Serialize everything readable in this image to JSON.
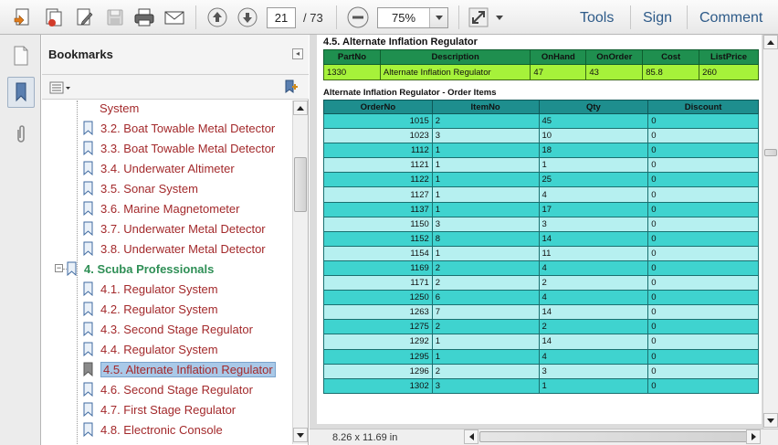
{
  "toolbar": {
    "current_page": "21",
    "total_pages": "/ 73",
    "zoom": "75%",
    "tools_label": "Tools",
    "sign_label": "Sign",
    "comment_label": "Comment"
  },
  "bookmarks_panel": {
    "title": "Bookmarks",
    "items": [
      {
        "label": "System"
      },
      {
        "label": "3.2. Boat Towable Metal Detector"
      },
      {
        "label": "3.3. Boat Towable Metal Detector"
      },
      {
        "label": "3.4. Underwater Altimeter"
      },
      {
        "label": "3.5. Sonar System"
      },
      {
        "label": "3.6. Marine Magnetometer"
      },
      {
        "label": "3.7. Underwater Metal Detector"
      },
      {
        "label": "3.8. Underwater Metal Detector"
      },
      {
        "label": "4. Scuba Professionals"
      },
      {
        "label": "4.1. Regulator System"
      },
      {
        "label": "4.2. Regulator System"
      },
      {
        "label": "4.3. Second Stage Regulator"
      },
      {
        "label": "4.4. Regulator System"
      },
      {
        "label": "4.5. Alternate Inflation Regulator"
      },
      {
        "label": "4.6. Second Stage Regulator"
      },
      {
        "label": "4.7. First Stage Regulator"
      },
      {
        "label": "4.8. Electronic Console"
      }
    ]
  },
  "document": {
    "heading": "4.5. Alternate Inflation Regulator",
    "part_headers": [
      "PartNo",
      "Description",
      "OnHand",
      "OnOrder",
      "Cost",
      "ListPrice"
    ],
    "part_row": [
      "1330",
      "Alternate Inflation Regulator",
      "47",
      "43",
      "85.8",
      "260"
    ],
    "items_title": "Alternate Inflation Regulator - Order Items",
    "items_headers": [
      "OrderNo",
      "ItemNo",
      "Qty",
      "Discount"
    ],
    "items_rows": [
      [
        "1015",
        "2",
        "45",
        "0"
      ],
      [
        "1023",
        "3",
        "10",
        "0"
      ],
      [
        "1112",
        "1",
        "18",
        "0"
      ],
      [
        "1121",
        "1",
        "1",
        "0"
      ],
      [
        "1122",
        "1",
        "25",
        "0"
      ],
      [
        "1127",
        "1",
        "4",
        "0"
      ],
      [
        "1137",
        "1",
        "17",
        "0"
      ],
      [
        "1150",
        "3",
        "3",
        "0"
      ],
      [
        "1152",
        "8",
        "14",
        "0"
      ],
      [
        "1154",
        "1",
        "11",
        "0"
      ],
      [
        "1169",
        "2",
        "4",
        "0"
      ],
      [
        "1171",
        "2",
        "2",
        "0"
      ],
      [
        "1250",
        "6",
        "4",
        "0"
      ],
      [
        "1263",
        "7",
        "14",
        "0"
      ],
      [
        "1275",
        "2",
        "2",
        "0"
      ],
      [
        "1292",
        "1",
        "14",
        "0"
      ],
      [
        "1295",
        "1",
        "4",
        "0"
      ],
      [
        "1296",
        "2",
        "3",
        "0"
      ],
      [
        "1302",
        "3",
        "1",
        "0"
      ]
    ],
    "page_size": "8.26 x 11.69 in"
  }
}
